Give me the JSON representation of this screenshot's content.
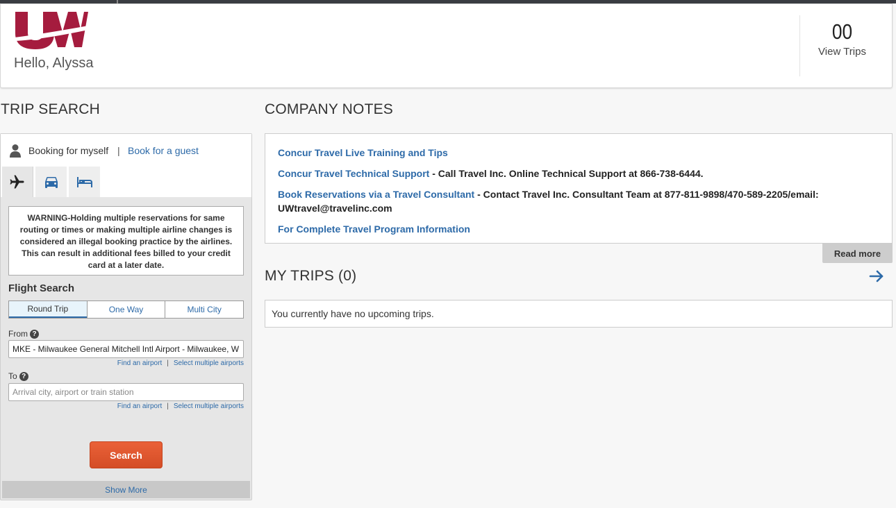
{
  "header": {
    "greeting": "Hello, Alyssa",
    "trip_count": "00",
    "view_trips_label": "View Trips",
    "brand_color": "#a51c3e"
  },
  "trip_search": {
    "title": "TRIP SEARCH",
    "booking_self": "Booking for myself",
    "booking_separator": "|",
    "booking_guest": "Book for a guest",
    "tabs": [
      {
        "icon": "airplane-icon",
        "active": true
      },
      {
        "icon": "car-icon",
        "active": false
      },
      {
        "icon": "hotel-bed-icon",
        "active": false
      }
    ],
    "warning": "WARNING-Holding multiple reservations for same routing or times or making multiple airline changes is considered an illegal booking practice by the airlines. This can result in additional fees billed to your credit card at a later date.",
    "flight_title": "Flight Search",
    "trip_types": [
      "Round Trip",
      "One Way",
      "Multi City"
    ],
    "selected_trip_type": "Round Trip",
    "from_label": "From",
    "from_value": "MKE - Milwaukee General Mitchell Intl Airport - Milwaukee, WI",
    "to_label": "To",
    "to_placeholder": "Arrival city, airport or train station",
    "find_airport": "Find an airport",
    "select_multiple": "Select multiple airports",
    "link_separator": "|",
    "search_label": "Search",
    "show_more": "Show More",
    "accent_color": "#2d6aa8",
    "search_color": "#e05a30"
  },
  "company_notes": {
    "title": "COMPANY NOTES",
    "notes": [
      {
        "link": "Concur Travel Live Training and Tips",
        "text": ""
      },
      {
        "link": "Concur Travel Technical Support",
        "text": " - Call Travel Inc. Online Technical Support at 866-738-6444."
      },
      {
        "link": "Book Reservations via a Travel Consultant",
        "text": " - Contact Travel Inc. Consultant Team at 877-811-9898/470-589-2205/email: UWtravel@travelinc.com"
      },
      {
        "link": "For Complete Travel Program Information",
        "text": ""
      }
    ],
    "read_more": "Read more"
  },
  "my_trips": {
    "title": "MY TRIPS (0)",
    "empty_message": "You currently have no upcoming trips."
  }
}
